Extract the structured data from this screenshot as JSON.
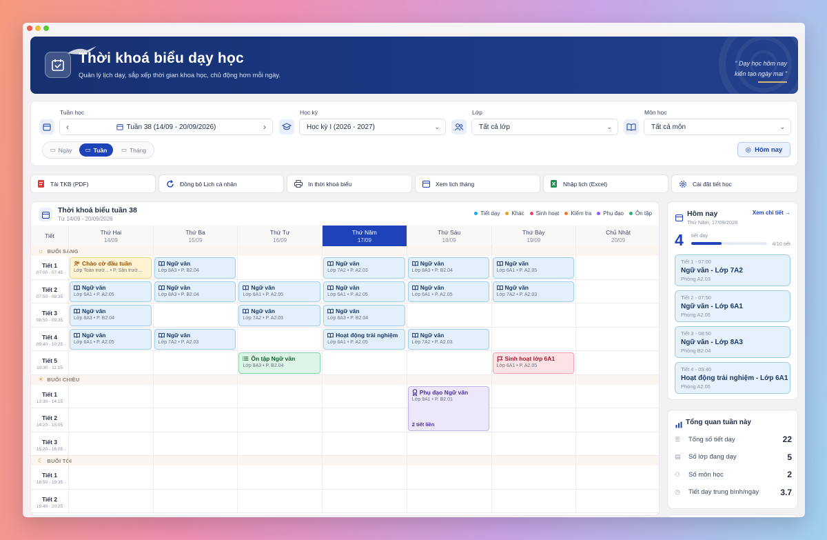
{
  "header": {
    "title": "Thời khoá biểu dạy học",
    "subtitle": "Quản lý lịch dạy, sắp xếp thời gian khoa học, chủ động hơn mỗi ngày.",
    "quote_line1": "“ Dạy học hôm nay",
    "quote_line2": "kiến tạo ngày mai ”"
  },
  "filters": {
    "week_label": "Tuần học",
    "week_value": "Tuần 38 (14/09 - 20/09/2026)",
    "semester_label": "Học kỳ",
    "semester_value": "Học kỳ I (2026 - 2027)",
    "class_label": "Lớp",
    "class_value": "Tất cả lớp",
    "subject_label": "Môn học",
    "subject_value": "Tất cả môn",
    "view_day": "Ngày",
    "view_week": "Tuần",
    "view_month": "Tháng",
    "today_button": "Hôm nay"
  },
  "actions": [
    {
      "label": "Tải TKB (PDF)",
      "icon": "pdf-icon"
    },
    {
      "label": "Đồng bộ Lịch cá nhân",
      "icon": "sync-icon"
    },
    {
      "label": "In thời khoá biểu",
      "icon": "printer-icon"
    },
    {
      "label": "Xem lịch tháng",
      "icon": "calendar-icon"
    },
    {
      "label": "Nhập lịch (Excel)",
      "icon": "excel-icon"
    },
    {
      "label": "Cài đặt tiết học",
      "icon": "gear-icon"
    }
  ],
  "schedule": {
    "title": "Thời khoá biểu tuần 38",
    "range": "Từ 14/09 - 20/09/2026",
    "legend": [
      {
        "label": "Tiết dạy",
        "color": "#1aa6e0"
      },
      {
        "label": "Khác",
        "color": "#f29d1a"
      },
      {
        "label": "Sinh hoạt",
        "color": "#e9435a"
      },
      {
        "label": "Kiểm tra",
        "color": "#f07a1a"
      },
      {
        "label": "Phụ đạo",
        "color": "#8b5cf6"
      },
      {
        "label": "Ôn tập",
        "color": "#22b573"
      }
    ],
    "period_header": "Tiết",
    "days": [
      {
        "name": "Thứ Hai",
        "date": "14/09"
      },
      {
        "name": "Thứ Ba",
        "date": "15/09"
      },
      {
        "name": "Thứ Tư",
        "date": "16/09"
      },
      {
        "name": "Thứ Năm",
        "date": "17/09"
      },
      {
        "name": "Thứ Sáu",
        "date": "18/09"
      },
      {
        "name": "Thứ Bảy",
        "date": "19/09"
      },
      {
        "name": "Chủ Nhật",
        "date": "20/09"
      }
    ],
    "sessions": [
      {
        "label": "BUỔI SÁNG",
        "periods": [
          {
            "name": "Tiết 1",
            "time": "07:00 - 07:45"
          },
          {
            "name": "Tiết 2",
            "time": "07:50 - 08:35"
          },
          {
            "name": "Tiết 3",
            "time": "08:50 - 09:35"
          },
          {
            "name": "Tiết 4",
            "time": "09:40 - 10:25"
          },
          {
            "name": "Tiết 5",
            "time": "10:30 - 11:15"
          }
        ]
      },
      {
        "label": "BUỔI CHIỀU",
        "periods": [
          {
            "name": "Tiết 1",
            "time": "13:30 - 14:15"
          },
          {
            "name": "Tiết 2",
            "time": "14:20 - 15:05"
          },
          {
            "name": "Tiết 3",
            "time": "15:20 - 16:05"
          }
        ]
      },
      {
        "label": "BUỔI TỐI",
        "periods": [
          {
            "name": "Tiết 1",
            "time": "18:50 - 19:35"
          },
          {
            "name": "Tiết 2",
            "time": "19:40 - 20:25"
          }
        ]
      }
    ],
    "events": [
      {
        "day": 0,
        "session": 0,
        "period": 0,
        "title": "Chào cờ đầu tuần",
        "sub": "Lớp Toàn trườ... • P. Sân trườ...",
        "kind": "yellow",
        "icon": "people-icon"
      },
      {
        "day": 1,
        "session": 0,
        "period": 0,
        "title": "Ngữ văn",
        "sub": "Lớp 8A3 • P. B2.04",
        "kind": "blue",
        "icon": "book-icon"
      },
      {
        "day": 3,
        "session": 0,
        "period": 0,
        "title": "Ngữ văn",
        "sub": "Lớp 7A2 • P. A2.03",
        "kind": "blue",
        "icon": "book-icon"
      },
      {
        "day": 4,
        "session": 0,
        "period": 0,
        "title": "Ngữ văn",
        "sub": "Lớp 8A3 • P. B2.04",
        "kind": "blue",
        "icon": "book-icon"
      },
      {
        "day": 5,
        "session": 0,
        "period": 0,
        "title": "Ngữ văn",
        "sub": "Lớp 6A1 • P. A2.05",
        "kind": "blue",
        "icon": "book-icon"
      },
      {
        "day": 0,
        "session": 0,
        "period": 1,
        "title": "Ngữ văn",
        "sub": "Lớp 6A1 • P. A2.05",
        "kind": "blue",
        "icon": "book-icon"
      },
      {
        "day": 1,
        "session": 0,
        "period": 1,
        "title": "Ngữ văn",
        "sub": "Lớp 8A3 • P. B2.04",
        "kind": "blue",
        "icon": "book-icon"
      },
      {
        "day": 2,
        "session": 0,
        "period": 1,
        "title": "Ngữ văn",
        "sub": "Lớp 6A1 • P. A2.05",
        "kind": "blue",
        "icon": "book-icon"
      },
      {
        "day": 3,
        "session": 0,
        "period": 1,
        "title": "Ngữ văn",
        "sub": "Lớp 6A1 • P. A2.05",
        "kind": "blue",
        "icon": "book-icon"
      },
      {
        "day": 4,
        "session": 0,
        "period": 1,
        "title": "Ngữ văn",
        "sub": "Lớp 6A1 • P. A2.05",
        "kind": "blue",
        "icon": "book-icon"
      },
      {
        "day": 5,
        "session": 0,
        "period": 1,
        "title": "Ngữ văn",
        "sub": "Lớp 7A2 • P. A2.03",
        "kind": "blue",
        "icon": "book-icon"
      },
      {
        "day": 0,
        "session": 0,
        "period": 2,
        "title": "Ngữ văn",
        "sub": "Lớp 8A3 • P. B2.04",
        "kind": "blue",
        "icon": "book-icon"
      },
      {
        "day": 2,
        "session": 0,
        "period": 2,
        "title": "Ngữ văn",
        "sub": "Lớp 7A2 • P. A2.03",
        "kind": "blue",
        "icon": "book-icon"
      },
      {
        "day": 3,
        "session": 0,
        "period": 2,
        "title": "Ngữ văn",
        "sub": "Lớp 8A3 • P. B2.04",
        "kind": "blue",
        "icon": "book-icon"
      },
      {
        "day": 0,
        "session": 0,
        "period": 3,
        "title": "Ngữ văn",
        "sub": "Lớp 6A1 • P. A2.05",
        "kind": "blue",
        "icon": "book-icon"
      },
      {
        "day": 1,
        "session": 0,
        "period": 3,
        "title": "Ngữ văn",
        "sub": "Lớp 7A2 • P. A2.03",
        "kind": "blue",
        "icon": "book-icon"
      },
      {
        "day": 3,
        "session": 0,
        "period": 3,
        "title": "Hoạt động trải nghiệm",
        "sub": "Lớp 6A1 • P. A2.05",
        "kind": "blue",
        "icon": "book-icon"
      },
      {
        "day": 4,
        "session": 0,
        "period": 3,
        "title": "Ngữ văn",
        "sub": "Lớp 7A2 • P. A2.03",
        "kind": "blue",
        "icon": "book-icon"
      },
      {
        "day": 2,
        "session": 0,
        "period": 4,
        "title": "Ôn tập Ngữ văn",
        "sub": "Lớp 8A3 • P. B2.04",
        "kind": "green",
        "icon": "list-icon"
      },
      {
        "day": 5,
        "session": 0,
        "period": 4,
        "title": "Sinh hoạt lớp 6A1",
        "sub": "Lớp 6A1 • P. A2.05",
        "kind": "red",
        "icon": "flag-icon"
      },
      {
        "day": 4,
        "session": 1,
        "period": 0,
        "span": 2,
        "title": "Phụ đạo Ngữ văn",
        "sub": "Lớp 9A1 • P. B2.01",
        "note": "2 tiết liền",
        "kind": "purple",
        "icon": "badge-icon"
      }
    ]
  },
  "today": {
    "title": "Hôm nay",
    "date": "Thứ Năm, 17/09/2026",
    "link": "Xem chi tiết →",
    "count": "4",
    "count_label": "tiết dạy",
    "progress_text": "4/10 tiết",
    "progress": 0.4,
    "items": [
      {
        "time": "Tiết 1 - 07:00",
        "title": "Ngữ văn - Lớp 7A2",
        "room": "Phòng A2.03"
      },
      {
        "time": "Tiết 2 - 07:50",
        "title": "Ngữ văn - Lớp 6A1",
        "room": "Phòng A2.05"
      },
      {
        "time": "Tiết 3 - 08:50",
        "title": "Ngữ văn - Lớp 8A3",
        "room": "Phòng B2.04"
      },
      {
        "time": "Tiết 4 - 09:40",
        "title": "Hoạt động trải nghiệm - Lớp 6A1",
        "room": "Phòng A2.05"
      }
    ]
  },
  "summary": {
    "title": "Tổng quan tuần này",
    "rows": [
      {
        "label": "Tổng số tiết dạy",
        "value": "22"
      },
      {
        "label": "Số lớp đang dạy",
        "value": "5"
      },
      {
        "label": "Số môn học",
        "value": "2"
      },
      {
        "label": "Tiết dạy trung bình/ngày",
        "value": "3.7"
      }
    ]
  },
  "colors": {
    "primary": "#1e43b8",
    "hero": "#1b3a86"
  }
}
